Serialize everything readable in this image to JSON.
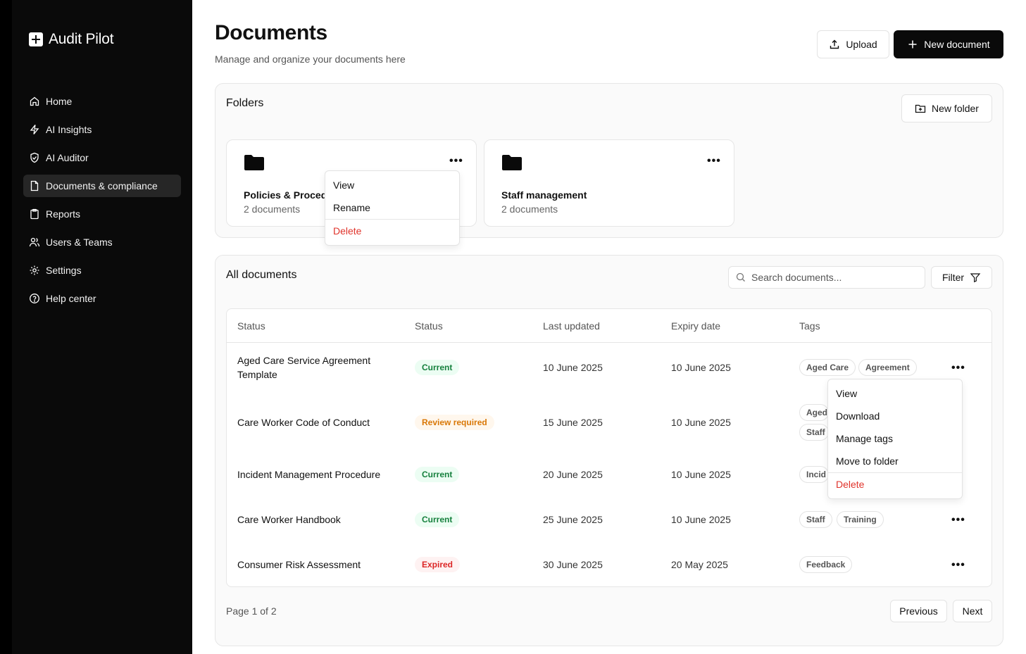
{
  "app": {
    "name": "Audit Pilot"
  },
  "sidebar": {
    "items": [
      {
        "label": "Home",
        "icon": "home-icon",
        "active": false
      },
      {
        "label": "AI Insights",
        "icon": "zap-icon",
        "active": false
      },
      {
        "label": "AI Auditor",
        "icon": "shield-check-icon",
        "active": false
      },
      {
        "label": "Documents & compliance",
        "icon": "file-icon",
        "active": true
      },
      {
        "label": "Reports",
        "icon": "clipboard-icon",
        "active": false
      },
      {
        "label": "Users & Teams",
        "icon": "users-icon",
        "active": false
      },
      {
        "label": "Settings",
        "icon": "gear-icon",
        "active": false
      },
      {
        "label": "Help center",
        "icon": "help-circle-icon",
        "active": false
      }
    ]
  },
  "header": {
    "title": "Documents",
    "subtitle": "Manage and organize your documents here",
    "upload_label": "Upload",
    "new_document_label": "New document"
  },
  "folders": {
    "title": "Folders",
    "new_folder_label": "New folder",
    "items": [
      {
        "name": "Policies & Procedures",
        "visible_name": "Policies & Procedu",
        "count": "2 documents"
      },
      {
        "name": "Staff management",
        "visible_name": "Staff management",
        "count": "2 documents"
      }
    ],
    "menu": {
      "view": "View",
      "rename": "Rename",
      "delete": "Delete"
    }
  },
  "documents": {
    "title": "All documents",
    "search_placeholder": "Search documents...",
    "filter_label": "Filter",
    "columns": [
      "Status",
      "Status",
      "Last updated",
      "Expiry date",
      "Tags"
    ],
    "rows": [
      {
        "name_line1": "Aged Care Service Agreement",
        "name_line2": "Template",
        "status": "Current",
        "status_kind": "current",
        "updated": "10 June 2025",
        "expiry": "10 June 2025",
        "tags": [
          "Aged Care",
          "Agreement"
        ]
      },
      {
        "name": "Care Worker Code of Conduct",
        "status": "Review required",
        "status_kind": "review",
        "updated": "15 June 2025",
        "expiry": "10 June 2025",
        "tags": [
          "Aged",
          "Staff"
        ]
      },
      {
        "name": "Incident Management Procedure",
        "status": "Current",
        "status_kind": "current",
        "updated": "20 June 2025",
        "expiry": "10 June 2025",
        "tags": [
          "Incid"
        ]
      },
      {
        "name": "Care Worker Handbook",
        "status": "Current",
        "status_kind": "current",
        "updated": "25 June 2025",
        "expiry": "10 June 2025",
        "tags": [
          "Staff",
          "Training"
        ]
      },
      {
        "name": "Consumer Risk Assessment",
        "status": "Expired",
        "status_kind": "expired",
        "updated": "30 June 2025",
        "expiry": "20 May 2025",
        "tags": [
          "Feedback"
        ]
      }
    ],
    "row_menu": {
      "view": "View",
      "download": "Download",
      "manage_tags": "Manage tags",
      "move_to_folder": "Move to folder",
      "delete": "Delete"
    }
  },
  "pagination": {
    "info": "Page 1 of 2",
    "previous": "Previous",
    "next": "Next"
  },
  "colors": {
    "sidebar_bg": "#0a0a0a",
    "accent_dark": "#0a0a0a",
    "danger": "#e0342c",
    "current": "#15803d",
    "review": "#d97706",
    "expired": "#dc2626"
  }
}
